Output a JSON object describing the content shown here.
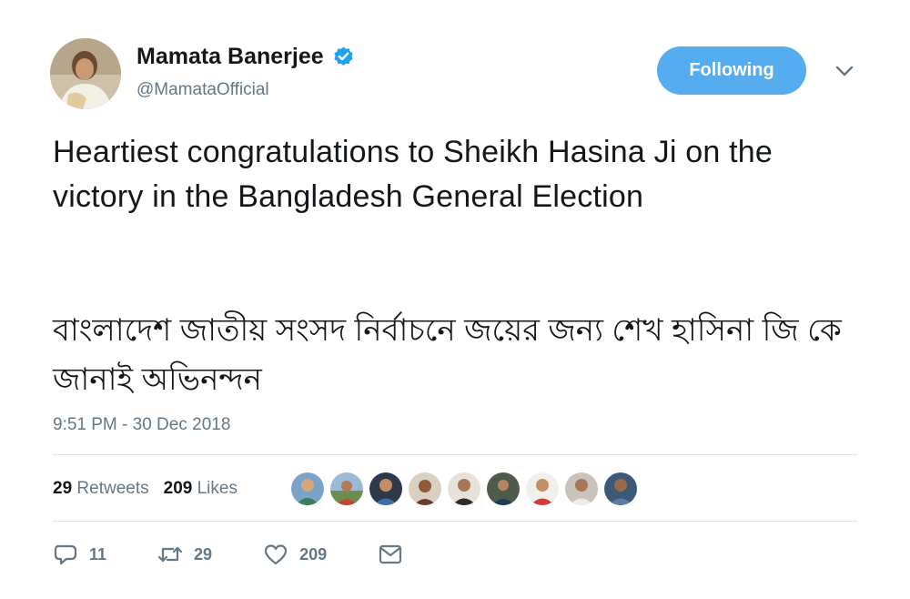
{
  "user": {
    "display_name": "Mamata Banerjee",
    "handle": "@MamataOfficial",
    "verified": true
  },
  "follow_button": {
    "label": "Following"
  },
  "tweet": {
    "text_en": "Heartiest congratulations to Sheikh Hasina Ji on the victory in the Bangladesh General Election",
    "text_bn": "বাংলাদেশ জাতীয় সংসদ নির্বাচনে জয়ের জন্য শেখ হাসিনা জি কে জানাই অভিনন্দন",
    "timestamp": "9:51 PM - 30 Dec 2018"
  },
  "stats": {
    "retweets_count": "29",
    "retweets_label": "Retweets",
    "likes_count": "209",
    "likes_label": "Likes"
  },
  "actions": {
    "reply_count": "11",
    "retweet_count": "29",
    "like_count": "209"
  },
  "colors": {
    "accent": "#55acee",
    "verified": "#1da1f2",
    "secondary_text": "#657786",
    "divider": "#e1e8ed"
  },
  "icons": [
    "verified-badge-icon",
    "chevron-down-icon",
    "reply-icon",
    "retweet-icon",
    "heart-icon",
    "direct-message-icon"
  ]
}
